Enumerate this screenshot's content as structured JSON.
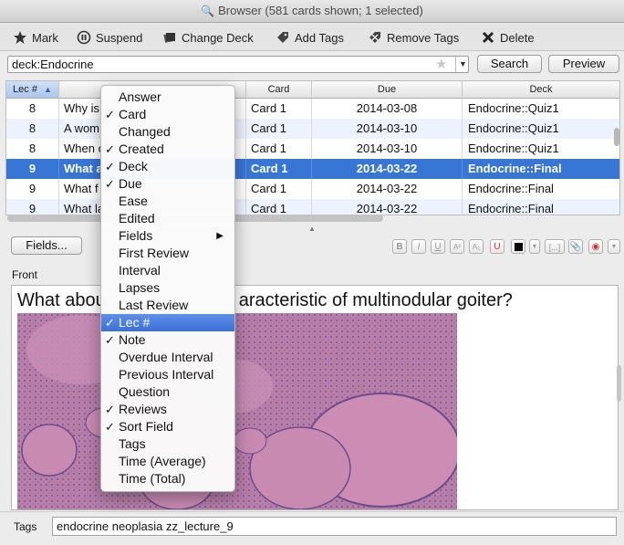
{
  "window": {
    "title": "Browser (581 cards shown; 1 selected)"
  },
  "toolbar": {
    "mark": "Mark",
    "suspend": "Suspend",
    "change_deck": "Change Deck",
    "add_tags": "Add Tags",
    "remove_tags": "Remove Tags",
    "delete": "Delete"
  },
  "search": {
    "value": "deck:Endocrine",
    "search_button": "Search",
    "preview_button": "Preview"
  },
  "table": {
    "columns": {
      "lec": "Lec #",
      "card": "Card",
      "due": "Due",
      "deck": "Deck"
    },
    "rows": [
      {
        "lec": "8",
        "sort": "Why is",
        "card": "Card 1",
        "due": "2014-03-08",
        "deck": "Endocrine::Quiz1"
      },
      {
        "lec": "8",
        "sort": "A wom",
        "card": "Card 1",
        "due": "2014-03-10",
        "deck": "Endocrine::Quiz1"
      },
      {
        "lec": "8",
        "sort": "When c",
        "card": "Card 1",
        "due": "2014-03-10",
        "deck": "Endocrine::Quiz1"
      },
      {
        "lec": "9",
        "sort": "What a",
        "card": "Card 1",
        "due": "2014-03-22",
        "deck": "Endocrine::Final"
      },
      {
        "lec": "9",
        "sort": "What f",
        "card": "Card 1",
        "due": "2014-03-22",
        "deck": "Endocrine::Final"
      },
      {
        "lec": "9",
        "sort": "What la",
        "card": "Card 1",
        "due": "2014-03-22",
        "deck": "Endocrine::Final"
      }
    ]
  },
  "editor": {
    "fields_button": "Fields...",
    "field_label": "Front",
    "question": "What abou",
    "question_tail": "aracteristic of multinodular goiter?"
  },
  "tags": {
    "label": "Tags",
    "value": "endocrine neoplasia zz_lecture_9"
  },
  "menu": {
    "items": [
      {
        "label": "Answer",
        "checked": false
      },
      {
        "label": "Card",
        "checked": true
      },
      {
        "label": "Changed",
        "checked": false
      },
      {
        "label": "Created",
        "checked": true
      },
      {
        "label": "Deck",
        "checked": true
      },
      {
        "label": "Due",
        "checked": true
      },
      {
        "label": "Ease",
        "checked": false
      },
      {
        "label": "Edited",
        "checked": false
      },
      {
        "label": "Fields",
        "checked": false,
        "submenu": true
      },
      {
        "label": "First Review",
        "checked": false
      },
      {
        "label": "Interval",
        "checked": false
      },
      {
        "label": "Lapses",
        "checked": false
      },
      {
        "label": "Last Review",
        "checked": false
      },
      {
        "label": "Lec #",
        "checked": true,
        "highlighted": true
      },
      {
        "label": "Note",
        "checked": true
      },
      {
        "label": "Overdue Interval",
        "checked": false
      },
      {
        "label": "Previous Interval",
        "checked": false
      },
      {
        "label": "Question",
        "checked": false
      },
      {
        "label": "Reviews",
        "checked": true
      },
      {
        "label": "Sort Field",
        "checked": true
      },
      {
        "label": "Tags",
        "checked": false
      },
      {
        "label": "Time (Average)",
        "checked": false
      },
      {
        "label": "Time (Total)",
        "checked": false
      }
    ]
  },
  "colors": {
    "selection": "#3876d6",
    "menu_highlight": "#3c6fd9"
  }
}
